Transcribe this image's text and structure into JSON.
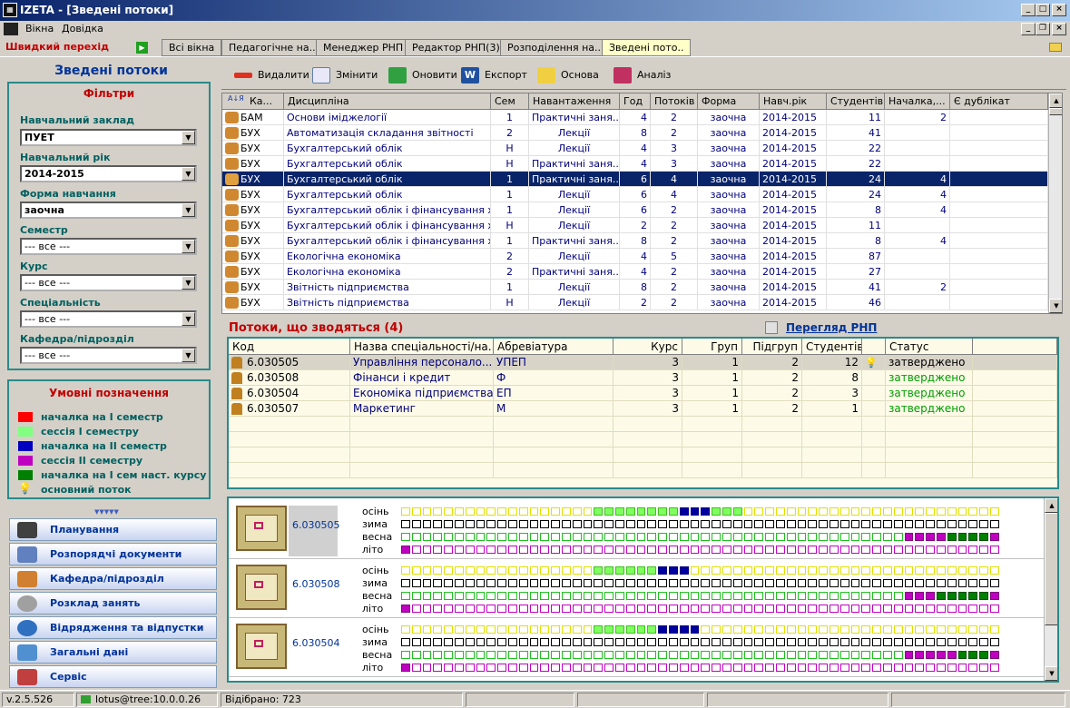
{
  "window": {
    "title": "IZETA - [Зведені потоки]",
    "icon": "izeta-logo-icon"
  },
  "menu": [
    "Вікна",
    "Довідка"
  ],
  "quick_nav": "Швидкий перехід",
  "tabs": [
    "Всі вікна",
    "Педагогічне на..",
    "Менеджер РНП",
    "Редактор РНП(3)",
    "Розподілення на..",
    "Зведені пото.."
  ],
  "active_tab": 5,
  "left": {
    "title": "Зведені потоки",
    "filters_title": "Фільтри",
    "filters": [
      {
        "label": "Навчальний заклад",
        "value": "ПУЕТ"
      },
      {
        "label": "Навчальний рік",
        "value": "2014-2015"
      },
      {
        "label": "Форма навчання",
        "value": "заочна"
      },
      {
        "label": "Семестр",
        "value": "--- все ---"
      },
      {
        "label": "Курс",
        "value": "--- все ---"
      },
      {
        "label": "Спеціальність",
        "value": "--- все ---"
      },
      {
        "label": "Кафедра/підрозділ",
        "value": "--- все ---"
      }
    ],
    "legend_title": "Умовні позначення",
    "legend": [
      {
        "label": "началка на І семестр",
        "color": "#ff0000"
      },
      {
        "label": "сессія І семестру",
        "color": "#80ff80"
      },
      {
        "label": "началка на ІІ семестр",
        "color": "#0000c0"
      },
      {
        "label": "сессія ІІ семестру",
        "color": "#c000c0"
      },
      {
        "label": "началка на І сем наст. курсу",
        "color": "#008000"
      },
      {
        "label": "основний поток",
        "color": "bulb"
      }
    ],
    "nav": [
      {
        "label": "Планування",
        "icon": "graduation-cap-icon"
      },
      {
        "label": "Розпорядчі документи",
        "icon": "document-icon"
      },
      {
        "label": "Кафедра/підрозділ",
        "icon": "briefcase-icon"
      },
      {
        "label": "Розклад занять",
        "icon": "clock-icon"
      },
      {
        "label": "Відрядження та відпустки",
        "icon": "globe-icon"
      },
      {
        "label": "Загальні дані",
        "icon": "database-icon"
      },
      {
        "label": "Сервіс",
        "icon": "books-icon"
      }
    ]
  },
  "toolbar": [
    {
      "label": "Видалити",
      "icon": "delete-icon"
    },
    {
      "label": "Змінити",
      "icon": "edit-icon"
    },
    {
      "label": "Оновити",
      "icon": "refresh-icon"
    },
    {
      "label": "Експорт",
      "icon": "word-export-icon"
    },
    {
      "label": "Основа",
      "icon": "pencil-icon"
    },
    {
      "label": "Аналіз",
      "icon": "analysis-icon"
    }
  ],
  "grid1": {
    "columns": [
      "Ка...",
      "Дисципліна",
      "Сем",
      "Навантаження",
      "Год",
      "Потоків",
      "Форма",
      "Навч.рік",
      "Студентів",
      "Началка,...",
      "Є дублікат"
    ],
    "rows": [
      [
        "БАМ",
        "Основи іміджелогії",
        "1",
        "Практичні заня...",
        "4",
        "2",
        "заочна",
        "2014-2015",
        "11",
        "2",
        ""
      ],
      [
        "БУХ",
        "Автоматизація складання звітності",
        "2",
        "Лекції",
        "8",
        "2",
        "заочна",
        "2014-2015",
        "41",
        "",
        ""
      ],
      [
        "БУХ",
        "Бухгалтерський облік",
        "Н",
        "Лекції",
        "4",
        "3",
        "заочна",
        "2014-2015",
        "22",
        "",
        ""
      ],
      [
        "БУХ",
        "Бухгалтерський облік",
        "Н",
        "Практичні заня...",
        "4",
        "3",
        "заочна",
        "2014-2015",
        "22",
        "",
        ""
      ],
      [
        "БУХ",
        "Бухгалтерський облік",
        "1",
        "Практичні заня...",
        "6",
        "4",
        "заочна",
        "2014-2015",
        "24",
        "4",
        ""
      ],
      [
        "БУХ",
        "Бухгалтерський облік",
        "1",
        "Лекції",
        "6",
        "4",
        "заочна",
        "2014-2015",
        "24",
        "4",
        ""
      ],
      [
        "БУХ",
        "Бухгалтерський облік і фінансування ха...",
        "1",
        "Лекції",
        "6",
        "2",
        "заочна",
        "2014-2015",
        "8",
        "4",
        ""
      ],
      [
        "БУХ",
        "Бухгалтерський облік і фінансування ха...",
        "Н",
        "Лекції",
        "2",
        "2",
        "заочна",
        "2014-2015",
        "11",
        "",
        ""
      ],
      [
        "БУХ",
        "Бухгалтерський облік і фінансування ха...",
        "1",
        "Практичні заня...",
        "8",
        "2",
        "заочна",
        "2014-2015",
        "8",
        "4",
        ""
      ],
      [
        "БУХ",
        "Екологічна економіка",
        "2",
        "Лекції",
        "4",
        "5",
        "заочна",
        "2014-2015",
        "87",
        "",
        ""
      ],
      [
        "БУХ",
        "Екологічна економіка",
        "2",
        "Практичні заня...",
        "4",
        "2",
        "заочна",
        "2014-2015",
        "27",
        "",
        ""
      ],
      [
        "БУХ",
        "Звітність підприємства",
        "1",
        "Лекції",
        "8",
        "2",
        "заочна",
        "2014-2015",
        "41",
        "2",
        ""
      ],
      [
        "БУХ",
        "Звітність підприємства",
        "Н",
        "Лекції",
        "2",
        "2",
        "заочна",
        "2014-2015",
        "46",
        "",
        ""
      ]
    ],
    "selected_row": 4
  },
  "section2": {
    "title": "Потоки, що зводяться (4)",
    "link": "Перегляд РНП"
  },
  "grid2": {
    "columns": [
      "Код",
      "Назва спеціальності/на...",
      "Абревіатура",
      "Курс",
      "Груп",
      "Підгруп",
      "Студентів",
      "",
      "Статус"
    ],
    "rows": [
      [
        "6.030505",
        "Управління персонало...",
        "УПЕП",
        "3",
        "1",
        "2",
        "12",
        "main",
        "затверджено"
      ],
      [
        "6.030508",
        "Фінанси і кредит",
        "Ф",
        "3",
        "1",
        "2",
        "8",
        "",
        "затверджено"
      ],
      [
        "6.030504",
        "Економіка підприємства",
        "ЕП",
        "3",
        "1",
        "2",
        "3",
        "",
        "затверджено"
      ],
      [
        "6.030507",
        "Маркетинг",
        "М",
        "3",
        "1",
        "2",
        "1",
        "",
        "затверджено"
      ]
    ]
  },
  "timeline": {
    "season_labels": [
      "осінь",
      "зима",
      "весна",
      "літо"
    ],
    "blocks": [
      {
        "code": "6.030505"
      },
      {
        "code": "6.030508"
      },
      {
        "code": "6.030504"
      }
    ]
  },
  "status": {
    "version": "v.2.5.526",
    "user": "lotus@tree:10.0.0.26",
    "selected": "Відібрано: 723"
  }
}
